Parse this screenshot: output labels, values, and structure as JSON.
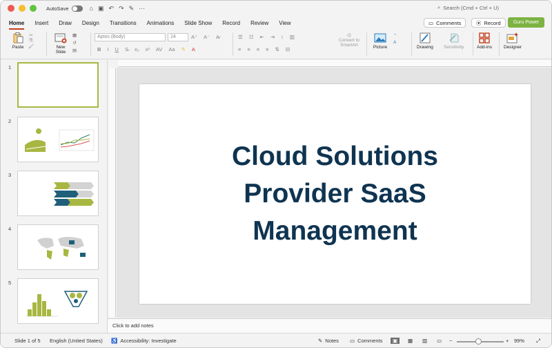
{
  "titlebar": {
    "autosave_label": "AutoSave",
    "search_placeholder": "Search (Cmd + Ctrl + U)"
  },
  "tabs": [
    {
      "label": "Home",
      "active": true
    },
    {
      "label": "Insert"
    },
    {
      "label": "Draw"
    },
    {
      "label": "Design"
    },
    {
      "label": "Transitions"
    },
    {
      "label": "Animations"
    },
    {
      "label": "Slide Show"
    },
    {
      "label": "Record"
    },
    {
      "label": "Review"
    },
    {
      "label": "View"
    }
  ],
  "top_buttons": {
    "comments": "Comments",
    "record": "Record",
    "guru": "Guru Power"
  },
  "ribbon": {
    "paste": "Paste",
    "new_slide": "New\nSlide",
    "font_name": "Aptos (Body)",
    "font_size": "24",
    "convert_smartart": "Convert to\nSmartArt",
    "picture": "Picture",
    "drawing": "Drawing",
    "sensitivity": "Sensitivity",
    "addins": "Add-ins",
    "designer": "Designer"
  },
  "thumbnails": [
    {
      "number": "1"
    },
    {
      "number": "2"
    },
    {
      "number": "3"
    },
    {
      "number": "4"
    },
    {
      "number": "5"
    }
  ],
  "slide": {
    "title_line1": "Cloud Solutions",
    "title_line2": "Provider SaaS",
    "title_line3": "Management"
  },
  "notes_placeholder": "Click to add notes",
  "status": {
    "slide_counter": "Slide 1 of 5",
    "language": "English (United States)",
    "accessibility": "Accessibility: Investigate",
    "notes": "Notes",
    "comments": "Comments",
    "zoom": "99%"
  },
  "colors": {
    "tab_underline": "#c43e1c",
    "accent_green": "#7cb342",
    "title_text": "#0f3451"
  }
}
